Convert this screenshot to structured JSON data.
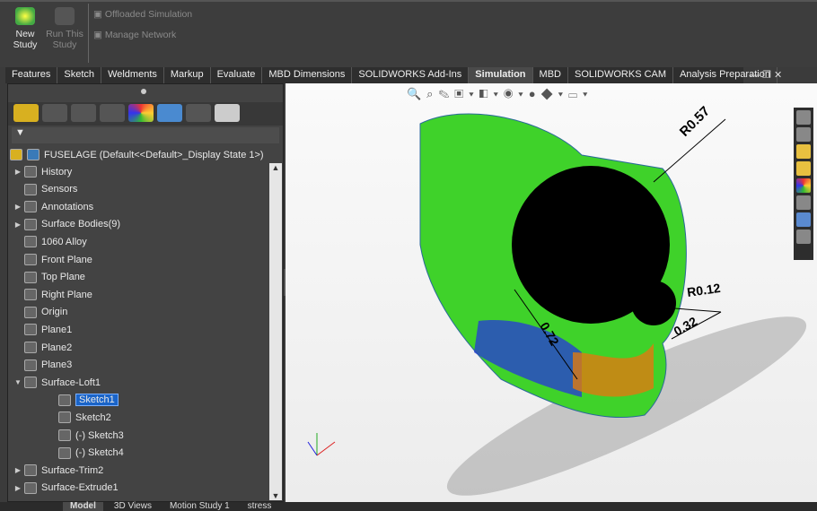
{
  "ribbon": {
    "new_study": "New Study",
    "run_study": "Run This Study",
    "offloaded": "Offloaded Simulation",
    "manage_network": "Manage Network"
  },
  "tabs": [
    "Features",
    "Sketch",
    "Weldments",
    "Markup",
    "Evaluate",
    "MBD Dimensions",
    "SOLIDWORKS Add-Ins",
    "Simulation",
    "MBD",
    "SOLIDWORKS CAM",
    "Analysis Preparation"
  ],
  "active_tab": "Simulation",
  "tree": {
    "root": "FUSELAGE  (Default<<Default>_Display State 1>)",
    "items": [
      {
        "label": "History",
        "exp": "▶"
      },
      {
        "label": "Sensors",
        "exp": ""
      },
      {
        "label": "Annotations",
        "exp": "▶"
      },
      {
        "label": "Surface Bodies(9)",
        "exp": "▶"
      },
      {
        "label": "1060 Alloy",
        "exp": ""
      },
      {
        "label": "Front Plane",
        "exp": ""
      },
      {
        "label": "Top Plane",
        "exp": ""
      },
      {
        "label": "Right Plane",
        "exp": ""
      },
      {
        "label": "Origin",
        "exp": ""
      },
      {
        "label": "Plane1",
        "exp": ""
      },
      {
        "label": "Plane2",
        "exp": ""
      },
      {
        "label": "Plane3",
        "exp": ""
      },
      {
        "label": "Surface-Loft1",
        "exp": "▼"
      },
      {
        "label": "Sketch1",
        "exp": "",
        "indent": 1,
        "selected": true
      },
      {
        "label": "Sketch2",
        "exp": "",
        "indent": 1
      },
      {
        "label": "(-) Sketch3",
        "exp": "",
        "indent": 1
      },
      {
        "label": "(-) Sketch4",
        "exp": "",
        "indent": 1
      },
      {
        "label": "Surface-Trim2",
        "exp": "▶"
      },
      {
        "label": "Surface-Extrude1",
        "exp": "▶"
      }
    ]
  },
  "dims": {
    "r1": "R0.57",
    "r2": "R0.12",
    "d1": "0.72",
    "d2": "0.32"
  },
  "bottom_tabs": [
    "Model",
    "3D Views",
    "Motion Study 1",
    "stress"
  ],
  "active_bottom": "Model"
}
